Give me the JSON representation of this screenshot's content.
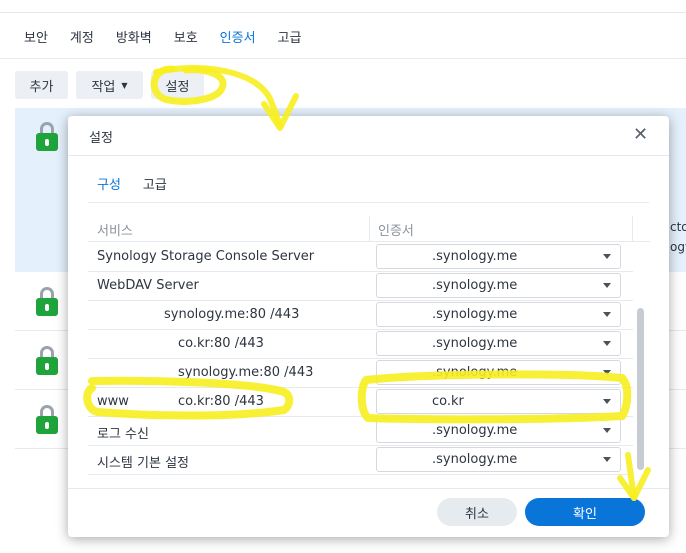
{
  "tabs": [
    "보안",
    "계정",
    "방화벽",
    "보호",
    "인증서",
    "고급"
  ],
  "toolbar": {
    "add": "추가",
    "action": "작업",
    "settings": "설정"
  },
  "side_text": [
    "cto",
    "ogy"
  ],
  "dialog": {
    "title": "설정",
    "close": "✕",
    "tabs": [
      "구성",
      "고급"
    ],
    "col_service": "서비스",
    "col_cert": "인증서",
    "rows": [
      {
        "service": "Synology Storage Console Server",
        "cert": ".synology.me"
      },
      {
        "service": "WebDAV Server",
        "cert": ".synology.me"
      },
      {
        "service": "synology.me:80 /443",
        "cert": ".synology.me"
      },
      {
        "service": "co.kr:80 /443",
        "cert": ".synology.me"
      },
      {
        "service": "synology.me:80 /443",
        "cert": ".synology.me"
      },
      {
        "service": "www",
        "service_domain": "co.kr:80 /443",
        "cert": "co.kr"
      },
      {
        "service": "로그 수신",
        "cert": ".synology.me"
      },
      {
        "service": "시스템 기본 설정",
        "cert": ".synology.me"
      }
    ],
    "cancel": "취소",
    "ok": "확인"
  },
  "colors": {
    "accent": "#0a75d9",
    "highlight": "#f7ee1e",
    "lock_green": "#1fa33b"
  }
}
